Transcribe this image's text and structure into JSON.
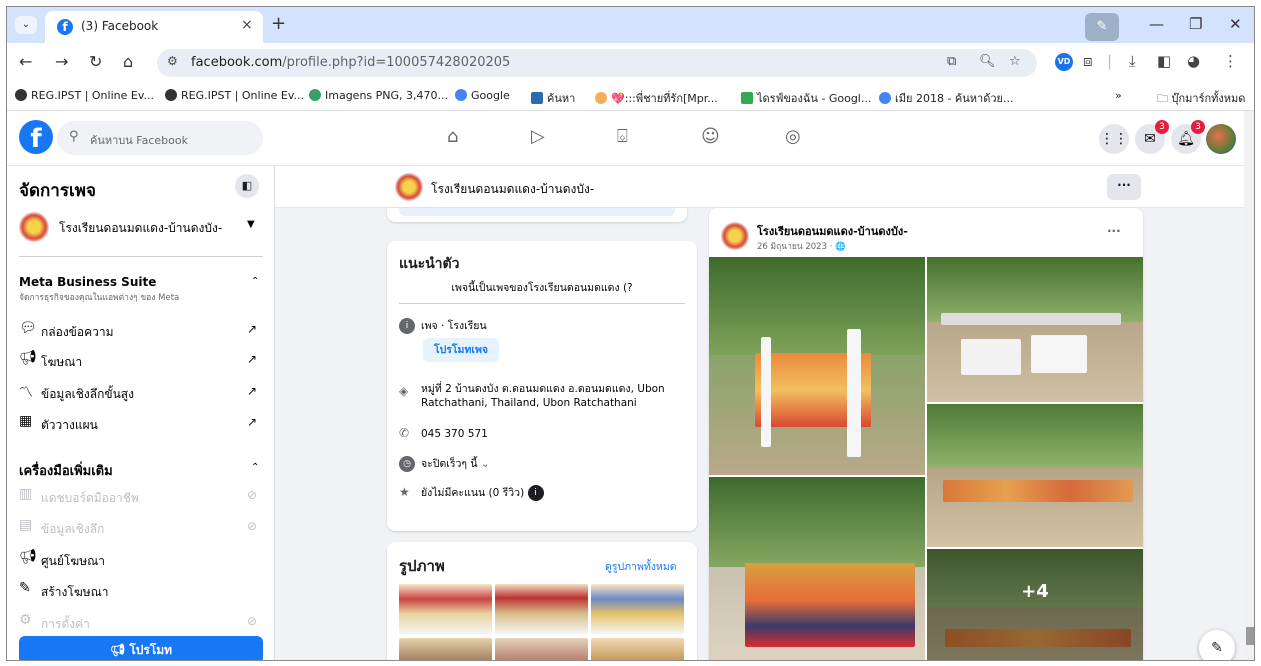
{
  "browser": {
    "tab_title": "(3) Facebook",
    "tab_close": "×",
    "new_tab": "+",
    "url_domain": "facebook.com",
    "url_path": "/profile.php?id=100057428020205"
  },
  "bookmarks": [
    {
      "label": "REG.IPST | Online Ev...",
      "color": "#333333"
    },
    {
      "label": "REG.IPST | Online Ev...",
      "color": "#333333"
    },
    {
      "label": "Imagens PNG, 3,470...",
      "color": "#38a169"
    },
    {
      "label": "Google",
      "color": "#4285f4"
    },
    {
      "label": "ค้นหา",
      "color": "#2b6cb0"
    },
    {
      "label": "💖:::พี่ชายที่รัก[Mpr...",
      "color": "#f6ad55"
    },
    {
      "label": "ไดรฟ์ของฉัน - Googl...",
      "color": "#34a853"
    },
    {
      "label": "เมีย 2018 - ค้นหาด้วย...",
      "color": "#4285f4"
    }
  ],
  "bookmarks_more": "»",
  "bookmarks_all": "บุ๊กมาร์กทั้งหมด",
  "fb": {
    "search_placeholder": "ค้นหาบน Facebook",
    "messenger_badge": "3",
    "notif_badge": "3"
  },
  "sidebar": {
    "title": "จัดการเพจ",
    "page_name": "โรงเรียนดอนมดแดง-บ้านดงบัง-",
    "mbs_title": "Meta Business Suite",
    "mbs_sub": "จัดการธุรกิจของคุณในแอพต่างๆ ของ Meta",
    "items": [
      {
        "label": "กล่องข้อความ",
        "icon": "chat-icon"
      },
      {
        "label": "โฆษณา",
        "icon": "megaphone-icon"
      },
      {
        "label": "ข้อมูลเชิงลึกขั้นสูง",
        "icon": "insights-icon"
      },
      {
        "label": "ตัววางแผน",
        "icon": "calendar-icon"
      }
    ],
    "tools_title": "เครื่องมือเพิ่มเติม",
    "tools": [
      {
        "label": "แดชบอร์ดมืออาชีพ",
        "icon": "dashboard-icon"
      },
      {
        "label": "ข้อมูลเชิงลึก",
        "icon": "chart-icon"
      },
      {
        "label": "ศูนย์โฆษณา",
        "icon": "megaphone-icon"
      },
      {
        "label": "สร้างโฆษณา",
        "icon": "edit-icon"
      },
      {
        "label": "การตั้งค่า",
        "icon": "gear-icon"
      }
    ],
    "promote": "โปรโมท"
  },
  "page": {
    "name": "โรงเรียนดอนมดแดง-บ้านดงบัง-",
    "more": "···"
  },
  "intro": {
    "title": "แนะนำตัว",
    "bio": "เพจนี้เป็นเพจของโรงเรียนดอนมดแดง (?",
    "category": "เพจ · โรงเรียน",
    "promote_page": "โปรโมทเพจ",
    "address": "หมู่ที่ 2 บ้านดงบัง ต.ดอนมดแดง อ.ดอนมดแดง, Ubon Ratchathani, Thailand, Ubon Ratchathani",
    "phone": "045 370 571",
    "hours": "จะปิดเร็วๆ นี้",
    "rating": "ยังไม่มีคะแนน (0 รีวิว)"
  },
  "photos": {
    "title": "รูปภาพ",
    "see_all": "ดูรูปภาพทั้งหมด"
  },
  "post": {
    "author": "โรงเรียนดอนมดแดง-บ้านดงบัง-",
    "date": "26 มิถุนายน 2023 · 🌐",
    "more": "···",
    "extra_photos": "+4"
  }
}
